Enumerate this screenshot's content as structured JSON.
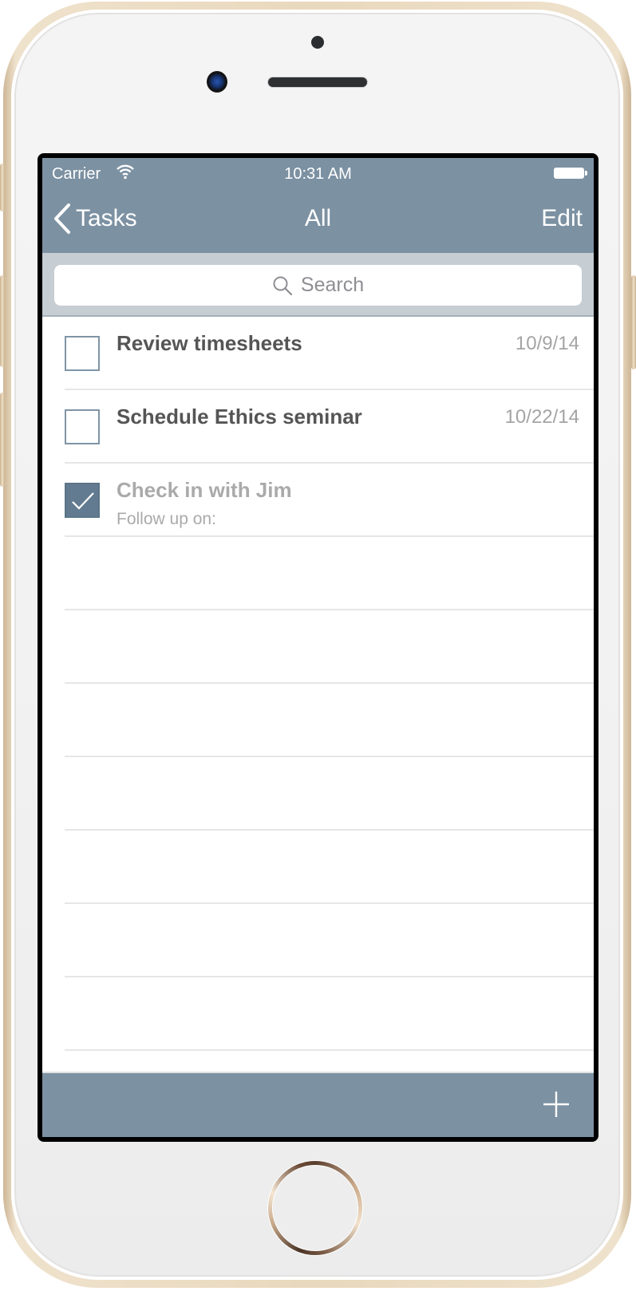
{
  "status_bar": {
    "carrier": "Carrier",
    "time": "10:31 AM",
    "wifi_icon": "wifi-icon",
    "battery_icon": "battery-full-icon"
  },
  "nav_bar": {
    "back_label": "Tasks",
    "back_icon": "chevron-left-icon",
    "title": "All",
    "edit_label": "Edit"
  },
  "search": {
    "placeholder": "Search",
    "value": "",
    "icon": "search-icon"
  },
  "tasks": [
    {
      "title": "Review timesheets",
      "date": "10/9/14",
      "subtitle": "",
      "completed": false
    },
    {
      "title": "Schedule Ethics seminar",
      "date": "10/22/14",
      "subtitle": "",
      "completed": false
    },
    {
      "title": "Check in with Jim",
      "date": "",
      "subtitle": "Follow up on:",
      "completed": true
    }
  ],
  "toolbar": {
    "add_icon": "plus-icon"
  },
  "colors": {
    "bar": "#7c91a2",
    "search_bar_bg": "#c6cdd3",
    "checkbox_border": "#7f94a6",
    "checkbox_checked": "#627b90",
    "title_text": "#555555",
    "completed_text": "#aaaaaa",
    "date_text": "#a4a4a4",
    "phone_frame": "#e8d8bd"
  }
}
